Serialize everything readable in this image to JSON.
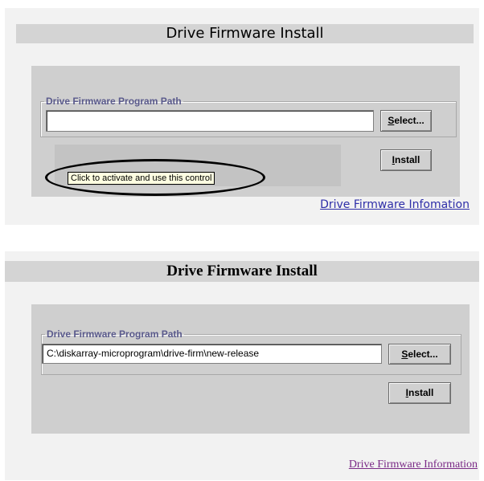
{
  "top_panel": {
    "title": "Drive Firmware Install",
    "group_label": "Drive Firmware Program Path",
    "path_value": "",
    "select_button": {
      "mnemonic": "S",
      "rest": "elect..."
    },
    "install_button": {
      "mnemonic": "I",
      "rest": "nstall"
    },
    "tooltip": "Click to activate and use this control",
    "link": "Drive Firmware Infomation"
  },
  "bottom_panel": {
    "title": "Drive Firmware Install",
    "group_label": "Drive Firmware Program Path",
    "path_value": "C:\\diskarray-microprogram\\drive-firm\\new-release",
    "select_button": {
      "mnemonic": "S",
      "rest": "elect..."
    },
    "install_button": {
      "mnemonic": "I",
      "rest": "nstall"
    },
    "link": "Drive Firmware Information"
  }
}
